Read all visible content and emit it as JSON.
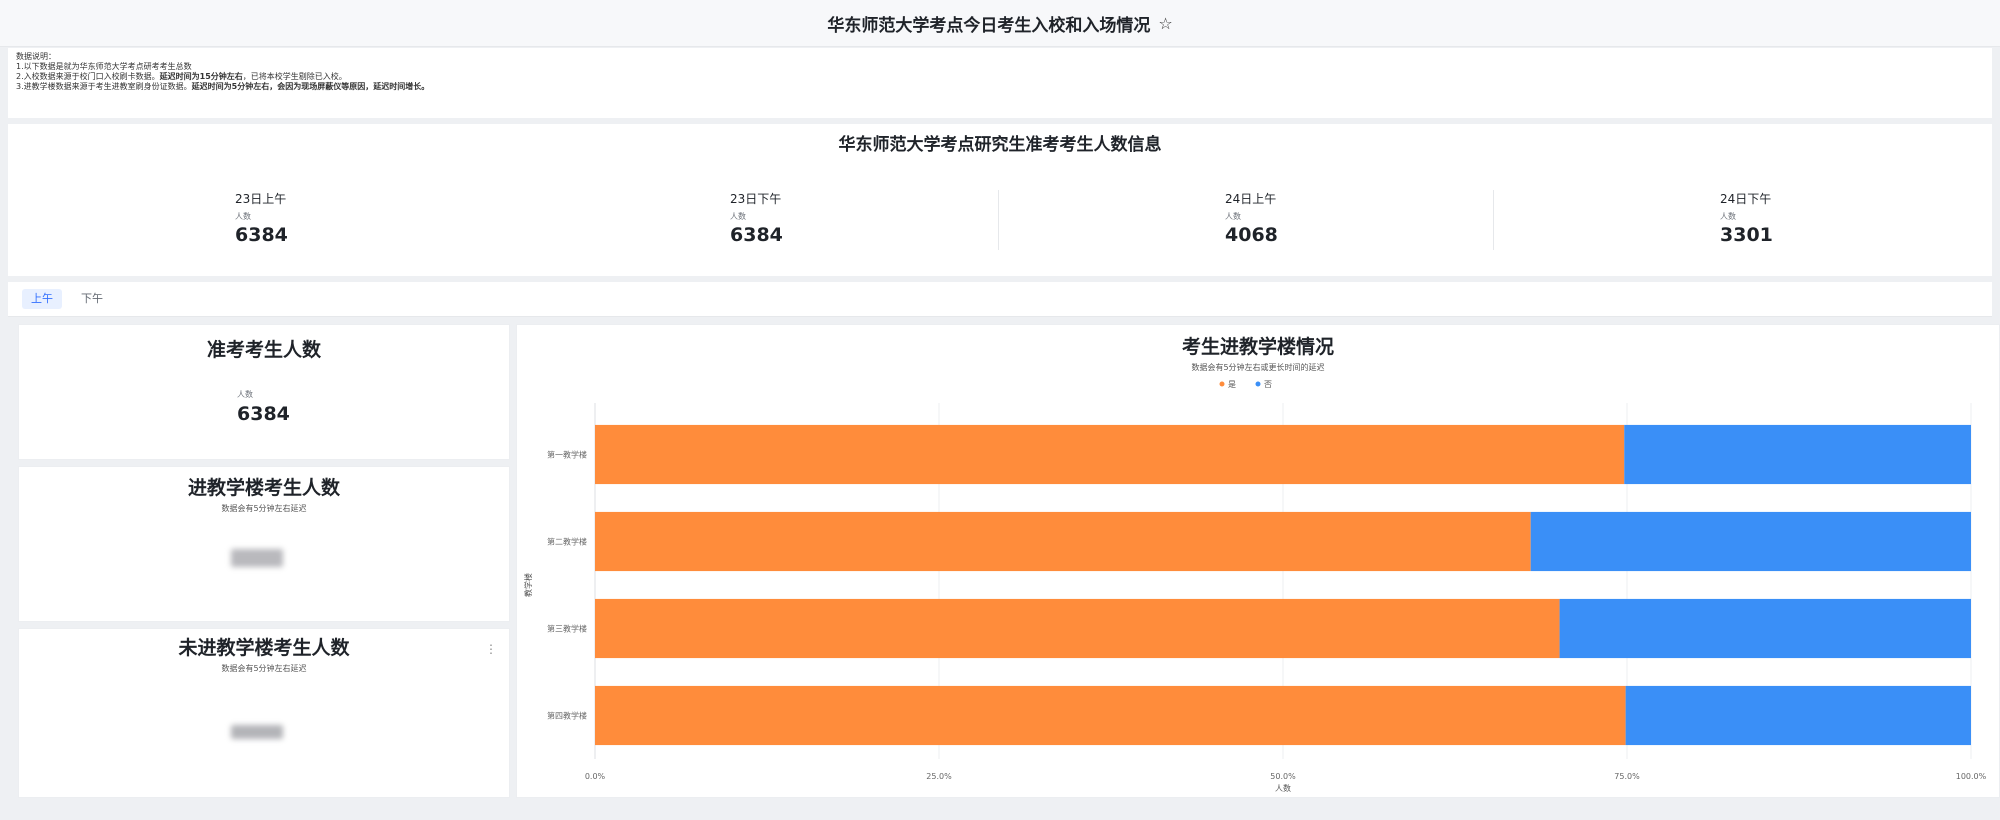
{
  "header": {
    "title": "华东师范大学考点今日考生入校和入场情况",
    "star_icon": "star-icon"
  },
  "notes": {
    "heading": "数据说明：",
    "line1": "1.以下数据是就为华东师范大学考点研考考生总数",
    "line2_pre": "2.入校数据来源于校门口入校刷卡数据。",
    "line2_bold": "延迟时间为15分钟左右",
    "line2_post": "，已将本校学生剔除已入校。",
    "line3_pre": "3.进教学楼数据来源于考生进教室刷身份证数据。",
    "line3_bold": "延迟时间为5分钟左右，会因为现场屏蔽仪等原因，延迟时间增长。"
  },
  "summary": {
    "title": "华东师范大学考点研究生准考考生人数信息",
    "kpis": [
      {
        "title": "23日上午",
        "label": "人数",
        "value": "6384"
      },
      {
        "title": "23日下午",
        "label": "人数",
        "value": "6384"
      },
      {
        "title": "24日上午",
        "label": "人数",
        "value": "4068"
      },
      {
        "title": "24日下午",
        "label": "人数",
        "value": "3301"
      }
    ]
  },
  "tabs": {
    "morning": "上午",
    "afternoon": "下午",
    "selected": "上午"
  },
  "cards": {
    "admitted": {
      "title": "准考考生人数",
      "label": "人数",
      "value": "6384"
    },
    "entered": {
      "title": "进教学楼考生人数",
      "subtitle": "数据会有5分钟左右延迟"
    },
    "not_entered": {
      "title": "未进教学楼考生人数",
      "subtitle": "数据会有5分钟左右延迟",
      "menu_icon": "more-vertical-icon"
    }
  },
  "chart_data": {
    "type": "bar",
    "orientation": "horizontal",
    "stacked": "percent",
    "title": "考生进教学楼情况",
    "subtitle": "数据会有5分钟左右或更长时间的延迟",
    "xlabel": "人数",
    "ylabel": "教学楼",
    "categories": [
      "第一教学楼",
      "第二教学楼",
      "第三教学楼",
      "第四教学楼"
    ],
    "series": [
      {
        "name": "是",
        "color": "#ff8c3b",
        "values": [
          74.8,
          68.0,
          70.1,
          74.9
        ]
      },
      {
        "name": "否",
        "color": "#3a8ff7",
        "values": [
          25.2,
          32.0,
          29.9,
          25.1
        ]
      }
    ],
    "xlim": [
      0,
      100
    ],
    "xticks": [
      "0.0%",
      "25.0%",
      "50.0%",
      "75.0%",
      "100.0%"
    ],
    "legend": "top-center",
    "grid": "vertical"
  }
}
